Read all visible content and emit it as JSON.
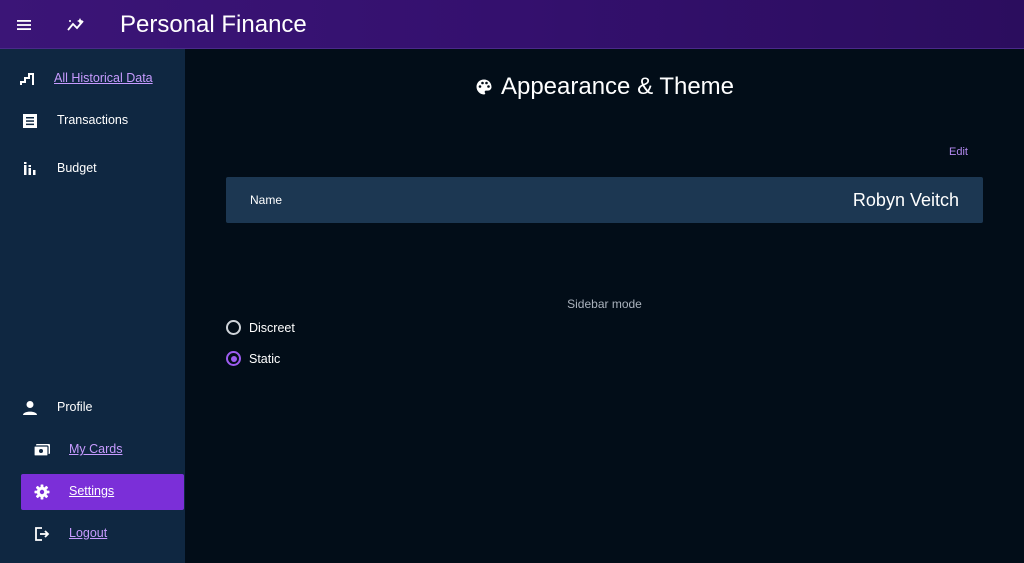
{
  "app": {
    "title": "Personal Finance"
  },
  "icons": {
    "menu": "menu-icon",
    "logo": "chart-sparkle-icon",
    "historical": "stairs-chart-icon",
    "transactions": "receipt-icon",
    "budget": "bar-chart-icon",
    "profile": "person-icon",
    "cards": "cards-icon",
    "settings": "gear-icon",
    "logout": "logout-icon",
    "palette": "palette-icon"
  },
  "colors": {
    "topbar": "#34106e",
    "sidebar": "#0f2741",
    "main_bg": "#020d18",
    "accent": "#7b2fd8",
    "link": "#c79bff",
    "card": "#1c3752"
  },
  "sidebar": {
    "items": [
      {
        "label": "All Historical Data",
        "link": true
      },
      {
        "label": "Transactions",
        "link": false
      },
      {
        "label": "Budget",
        "link": false
      }
    ],
    "bottom": [
      {
        "label": "Profile",
        "link": false
      },
      {
        "label": "My Cards",
        "link": true
      },
      {
        "label": "Settings",
        "link": true,
        "active": true
      },
      {
        "label": "Logout",
        "link": true
      }
    ]
  },
  "main": {
    "title": "Appearance & Theme",
    "edit_label": "Edit",
    "name_label": "Name",
    "name_value": "Robyn Veitch",
    "sidebar_mode_label": "Sidebar mode",
    "sidebar_mode_options": [
      {
        "label": "Discreet",
        "selected": false
      },
      {
        "label": "Static",
        "selected": true
      }
    ]
  }
}
